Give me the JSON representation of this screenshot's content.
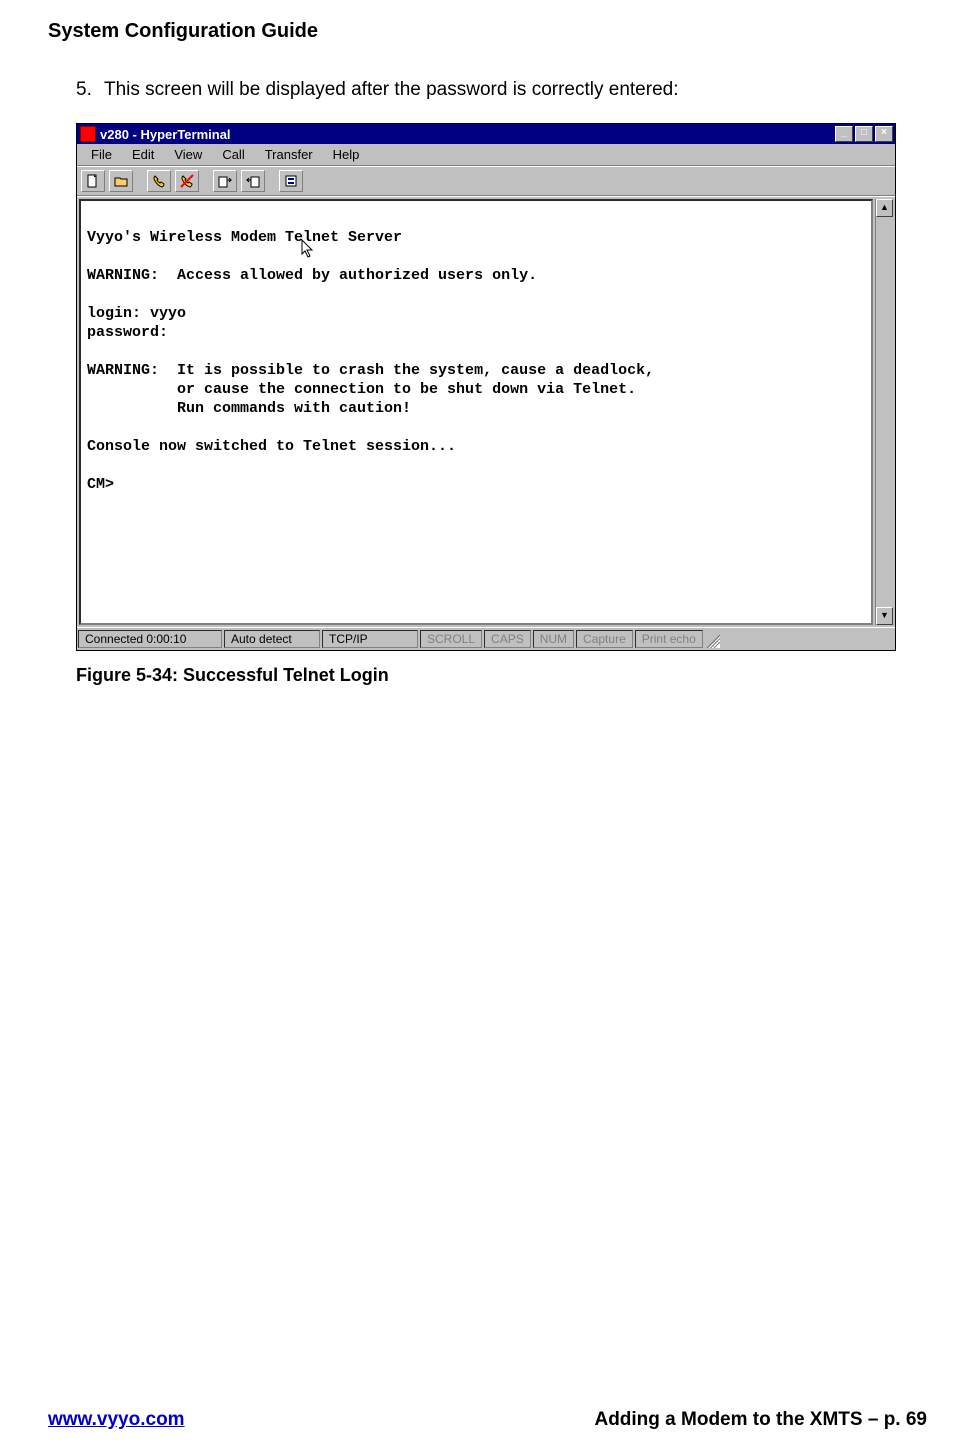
{
  "doc": {
    "header": "System Configuration Guide",
    "step_number": "5.",
    "step_text": "This screen will be displayed after the password is correctly entered:",
    "figure_caption": "Figure 5-34: Successful Telnet Login",
    "footer_link": "www.vyyo.com",
    "footer_right": "Adding a Modem to the XMTS – p. 69"
  },
  "window": {
    "title": "v280 - HyperTerminal",
    "menu": [
      "File",
      "Edit",
      "View",
      "Call",
      "Transfer",
      "Help"
    ],
    "winbtn_min": "_",
    "winbtn_max": "□",
    "winbtn_close": "×",
    "scroll_up": "▲",
    "scroll_down": "▼"
  },
  "terminal": {
    "content": "\nVyyo's Wireless Modem Telnet Server\n\nWARNING:  Access allowed by authorized users only.\n\nlogin: vyyo\npassword:\n\nWARNING:  It is possible to crash the system, cause a deadlock,\n          or cause the connection to be shut down via Telnet.\n          Run commands with caution!\n\nConsole now switched to Telnet session...\n\nCM>"
  },
  "status": {
    "connected": "Connected 0:00:10",
    "detect": "Auto detect",
    "proto": "TCP/IP",
    "scroll": "SCROLL",
    "caps": "CAPS",
    "num": "NUM",
    "capture": "Capture",
    "echo": "Print echo"
  }
}
